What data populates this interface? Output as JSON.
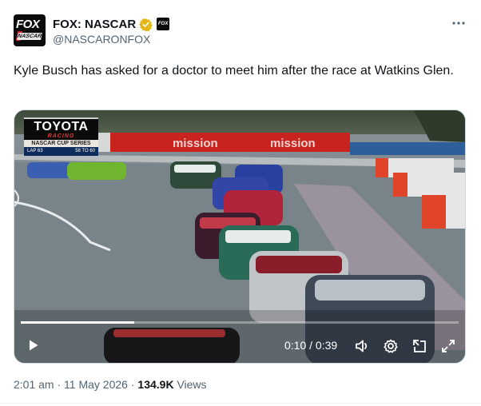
{
  "author": {
    "avatar_text_top": "FOX",
    "avatar_text_bottom": "NASCAR",
    "display_name": "FOX: NASCAR",
    "handle": "@NASCARONFOX",
    "affiliate_badge": "FOX"
  },
  "tweet": {
    "text": "Kyle Busch has asked for a doctor to meet him after the race at Watkins Glen."
  },
  "video": {
    "graphic": {
      "brand": "TOYOTA",
      "brand_sub": "RACING",
      "series": "NASCAR CUP SERIES",
      "lap_label": "LAP 63",
      "lap_range": "58 TO 60"
    },
    "track_banner": "mission",
    "current_time": "0:10",
    "duration": "0:39",
    "time_display": "0:10 / 0:39",
    "progress": 0.26
  },
  "meta": {
    "time": "2:01 am",
    "date": "11 May 2026",
    "separator": " · ",
    "views_count": "134.9K",
    "views_label": "Views"
  },
  "colors": {
    "verified_gold": "#e2b719",
    "text_primary": "#0f1419",
    "text_secondary": "#536471"
  },
  "icons": [
    "more-icon",
    "verified-icon",
    "play-icon",
    "volume-icon",
    "settings-icon",
    "minimize-icon",
    "fullscreen-icon"
  ]
}
